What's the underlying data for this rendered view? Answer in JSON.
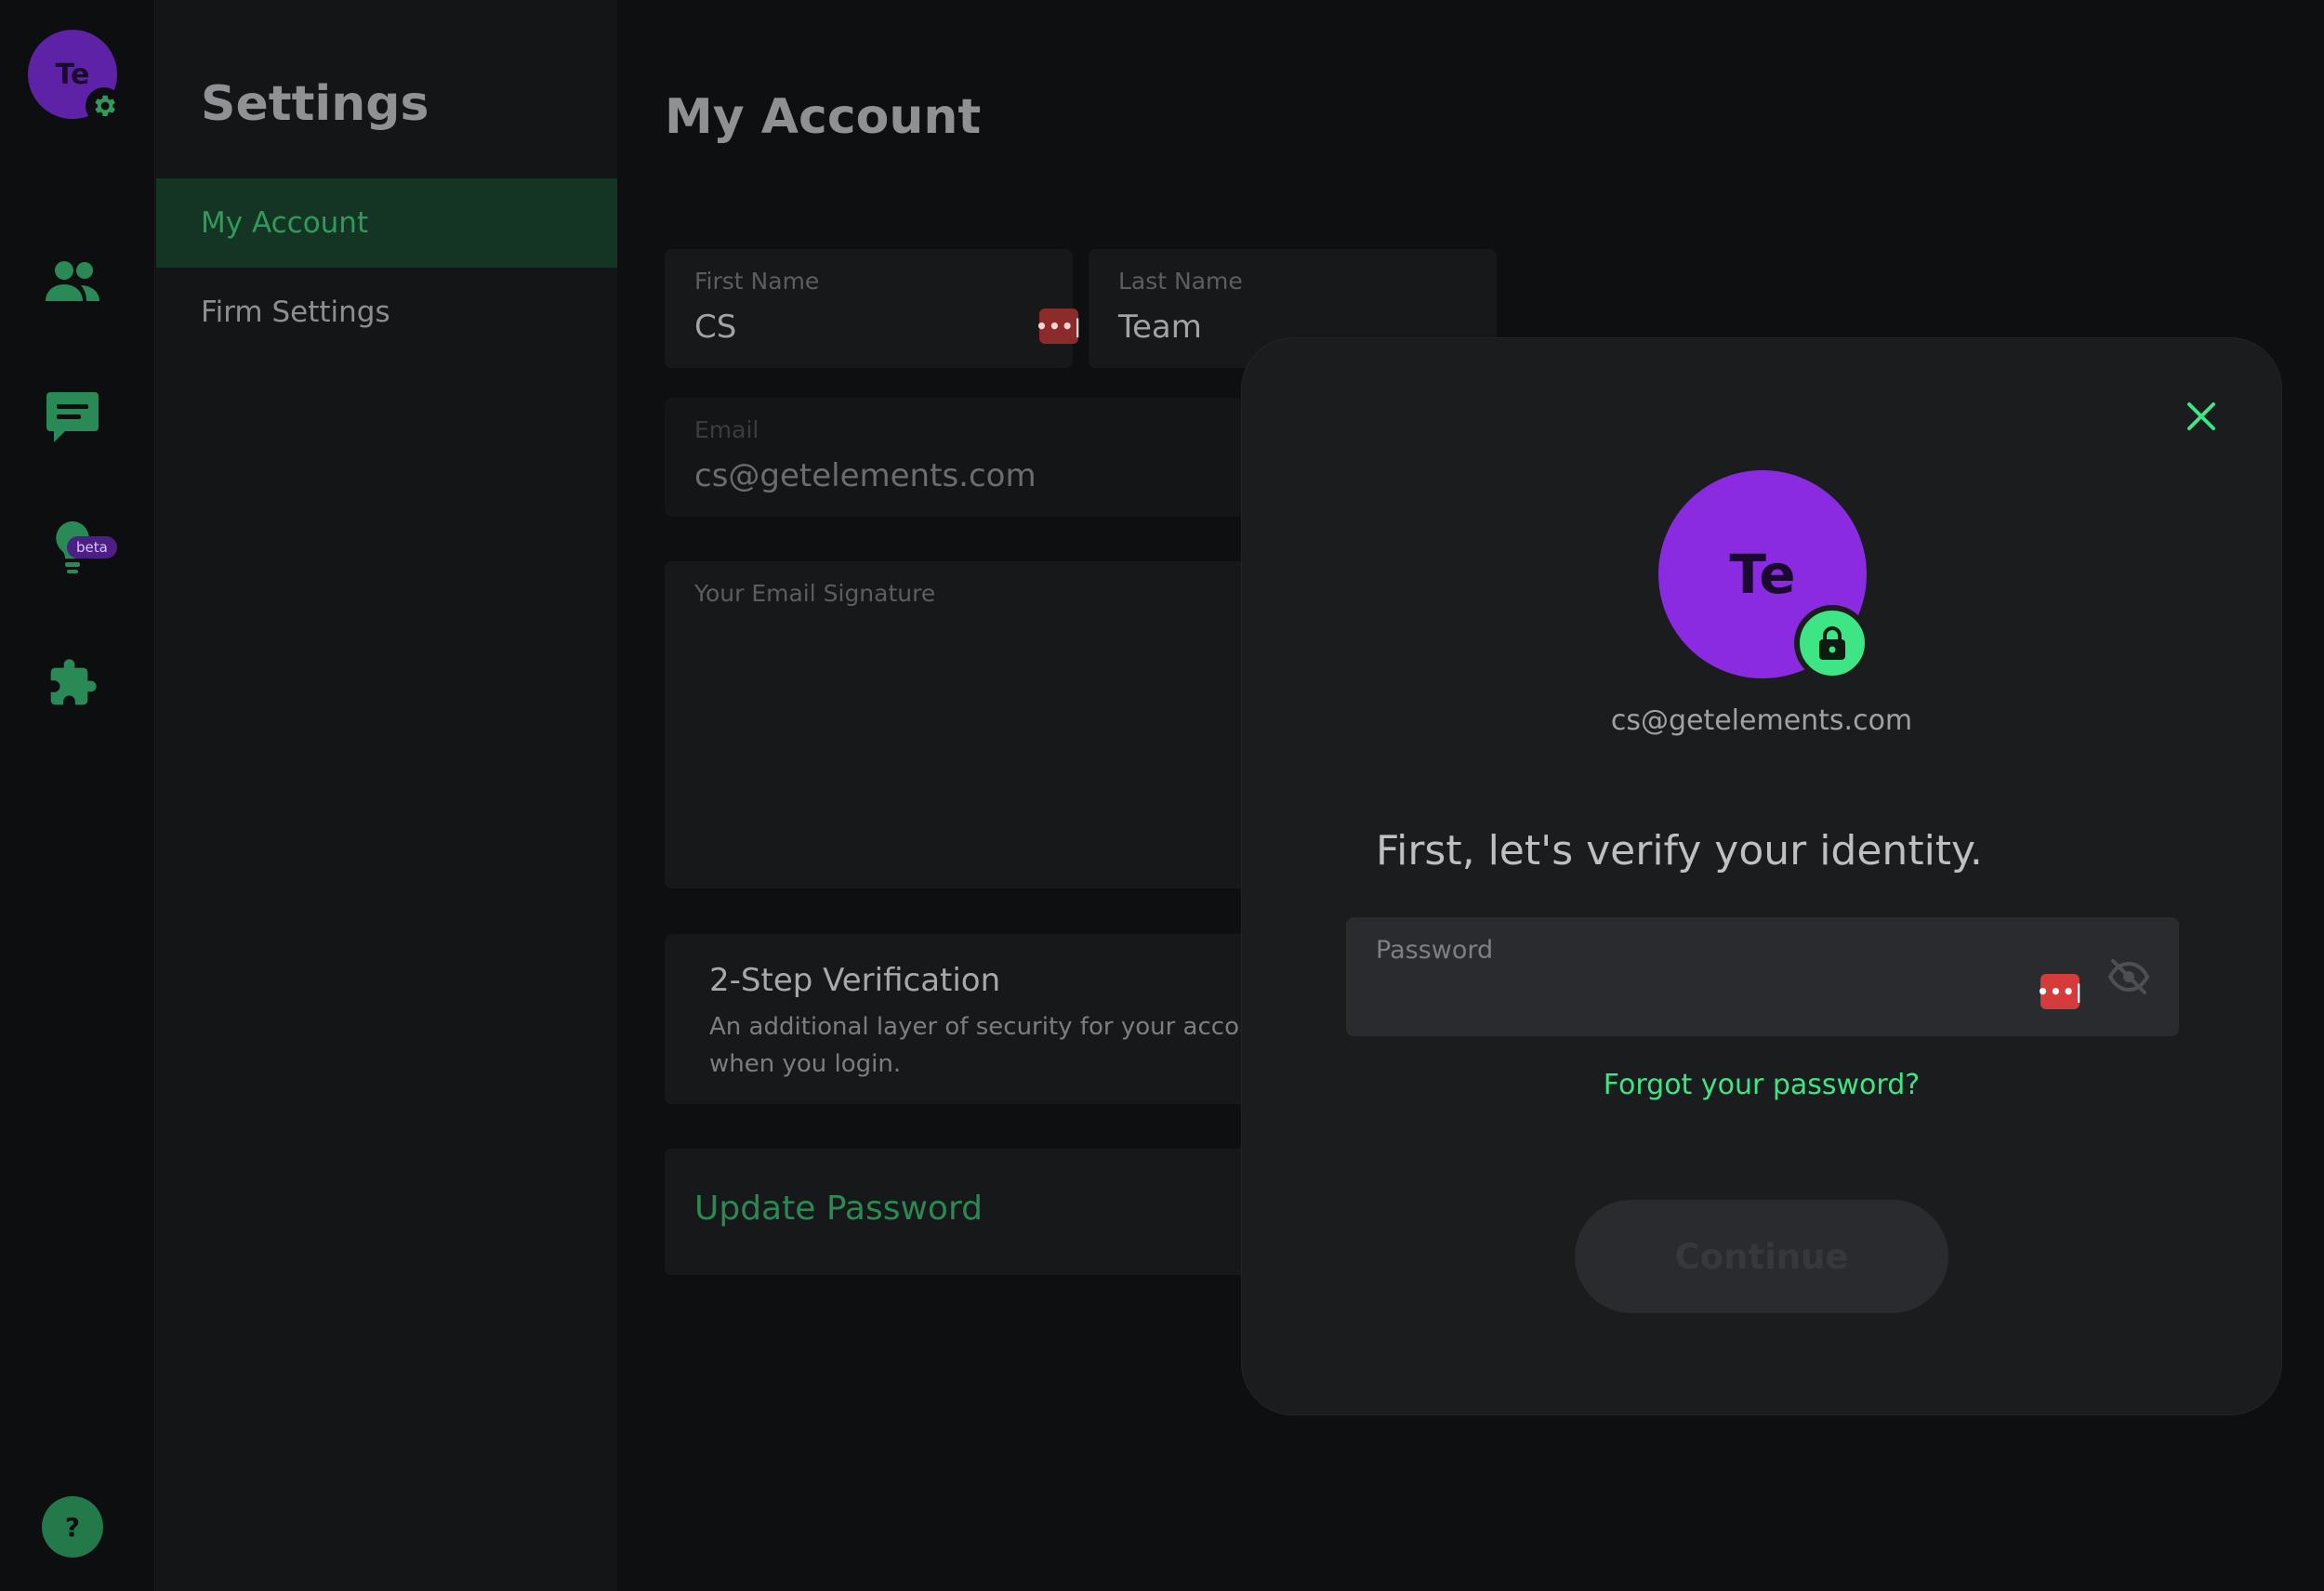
{
  "rail": {
    "avatar_initials": "Te",
    "icons": [
      "gear-icon",
      "people-icon",
      "chat-icon",
      "lightbulb-icon",
      "puzzle-icon",
      "help-icon"
    ],
    "beta_label": "beta",
    "help_label": "?"
  },
  "settings_nav": {
    "title": "Settings",
    "items": [
      {
        "label": "My Account",
        "active": true
      },
      {
        "label": "Firm Settings",
        "active": false
      }
    ]
  },
  "main": {
    "title": "My Account",
    "first_name": {
      "label": "First Name",
      "value": "CS"
    },
    "last_name": {
      "label": "Last Name",
      "value": "Team"
    },
    "email": {
      "label": "Email",
      "value": "cs@getelements.com"
    },
    "signature": {
      "label": "Your Email Signature"
    },
    "two_step": {
      "title": "2-Step Verification",
      "description_line1": "An additional layer of security for your account",
      "description_line2": "when you login."
    },
    "update_password_label": "Update Password",
    "password_manager_glyph": "•••|"
  },
  "modal": {
    "avatar_initials": "Te",
    "email": "cs@getelements.com",
    "heading": "First, let's verify your identity.",
    "password_label": "Password",
    "password_value": "",
    "forgot_link": "Forgot your password?",
    "continue_label": "Continue"
  },
  "colors": {
    "accent_green": "#3ee584",
    "nav_active_bg": "#143523",
    "avatar_purple": "#8a2be2",
    "password_manager_red": "#d63b3b"
  }
}
